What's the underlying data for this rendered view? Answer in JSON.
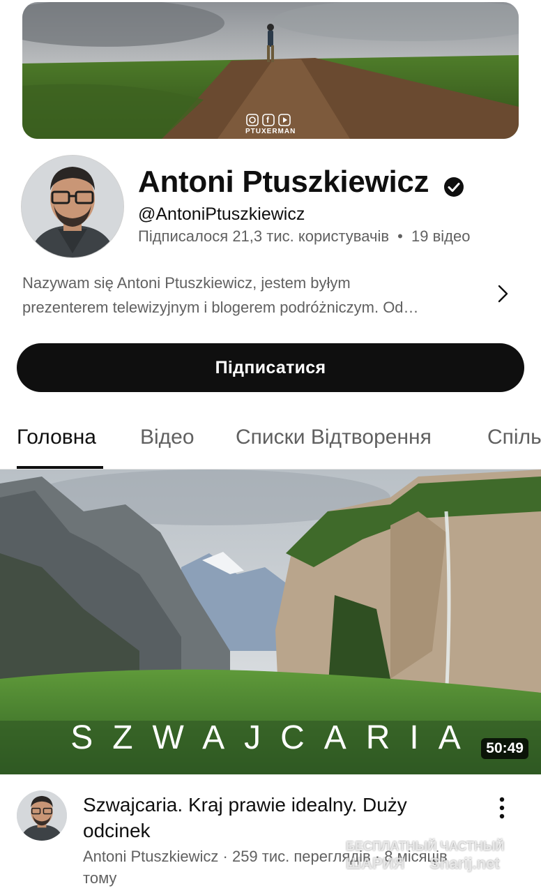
{
  "banner": {
    "social_icons": [
      "instagram-icon",
      "facebook-icon",
      "youtube-icon"
    ],
    "brand_text": "PTUXERMAN"
  },
  "channel": {
    "name": "Antoni Ptuszkiewicz",
    "verified_icon": "verified-check-icon",
    "handle": "@AntoniPtuszkiewicz",
    "subscribers": "Підписалося 21,3 тис. користувачів",
    "separator": "•",
    "video_count": "19 відео",
    "description_line1": "Nazywam się Antoni Ptuszkiewicz, jestem byłym",
    "description_line2": "prezenterem telewizyjnym i blogerem podróżniczym. Od…",
    "subscribe_label": "Підписатися"
  },
  "tabs": [
    {
      "label": "Головна",
      "active": true
    },
    {
      "label": "Відео",
      "active": false
    },
    {
      "label": "Списки Відтворення",
      "active": false
    },
    {
      "label": "Спіль",
      "active": false
    }
  ],
  "video": {
    "thumbnail_text": "SZWAJCARIA",
    "duration": "50:49",
    "title": "Szwajcaria. Kraj prawie idealny. Duży odcinek",
    "meta": "Antoni Ptuszkiewicz · 259 тис. переглядів · 8 місяців тому"
  },
  "watermark": {
    "line1": "БЕСПЛАТНЫЙ ЧАСТНЫЙ",
    "line2": "ШАРИЯ",
    "line3": "Sharij.net"
  },
  "colors": {
    "text_primary": "#0f0f0f",
    "text_secondary": "#606060",
    "button_bg": "#0f0f0f",
    "button_text": "#ffffff"
  }
}
